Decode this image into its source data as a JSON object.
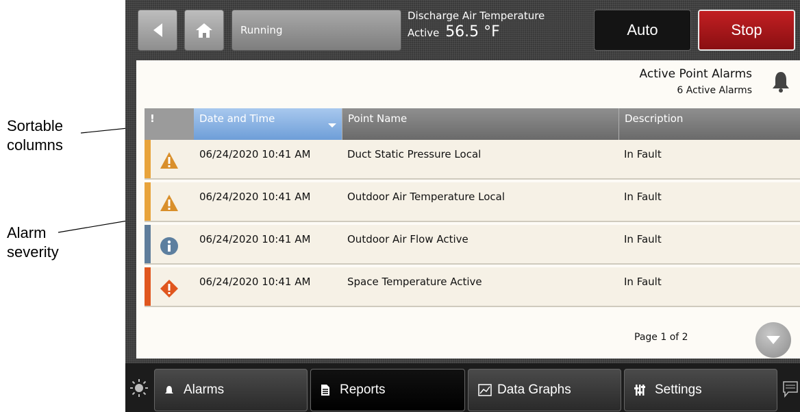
{
  "annotations": {
    "sortable": [
      "Sortable",
      "columns"
    ],
    "severity": [
      "Alarm",
      "severity"
    ]
  },
  "topbar": {
    "back_icon": "back-arrow-icon",
    "home_icon": "home-icon",
    "status": "Running",
    "dat_label": "Discharge Air Temperature",
    "dat_state": "Active",
    "dat_value": "56.5 °F",
    "auto_label": "Auto",
    "stop_label": "Stop"
  },
  "alarms": {
    "title": "Active Point Alarms",
    "count": "6 Active Alarms",
    "bell_icon": "bell-icon",
    "columns": {
      "severity": "!",
      "datetime": "Date and Time",
      "point": "Point Name",
      "description": "Description"
    },
    "rows": [
      {
        "severity": "warning",
        "icon": "warning-triangle-icon",
        "datetime": "06/24/2020 10:41 AM",
        "point": "Duct Static Pressure Local",
        "description": "In Fault"
      },
      {
        "severity": "warning",
        "icon": "warning-triangle-icon",
        "datetime": "06/24/2020 10:41 AM",
        "point": "Outdoor Air Temperature Local",
        "description": "In Fault"
      },
      {
        "severity": "info",
        "icon": "info-icon",
        "datetime": "06/24/2020 10:41 AM",
        "point": "Outdoor Air Flow Active",
        "description": "In Fault"
      },
      {
        "severity": "critical",
        "icon": "critical-diamond-icon",
        "datetime": "06/24/2020 10:41 AM",
        "point": "Space Temperature Active",
        "description": "In Fault"
      }
    ],
    "pager": "Page 1 of 2"
  },
  "colors": {
    "warning": "#e8a33a",
    "info": "#5f7d9a",
    "critical": "#e0561e",
    "stop": "#b51a1d"
  },
  "nav": {
    "alarms": "Alarms",
    "reports": "Reports",
    "data_graphs": "Data Graphs",
    "settings": "Settings"
  }
}
